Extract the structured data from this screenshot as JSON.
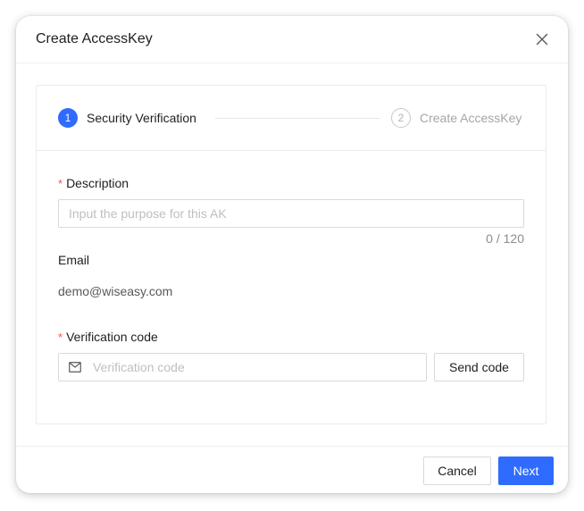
{
  "dialog": {
    "title": "Create AccessKey"
  },
  "steps": [
    {
      "number": "1",
      "label": "Security Verification",
      "state": "active"
    },
    {
      "number": "2",
      "label": "Create AccessKey",
      "state": "pending"
    }
  ],
  "form": {
    "description": {
      "required_mark": "*",
      "label": "Description",
      "value": "",
      "placeholder": "Input the purpose for this AK",
      "counter": "0 / 120"
    },
    "email": {
      "label": "Email",
      "value": "demo@wiseasy.com"
    },
    "verification_code": {
      "required_mark": "*",
      "label": "Verification code",
      "value": "",
      "placeholder": "Verification code",
      "icon": "mail-icon",
      "send_button_label": "Send code"
    }
  },
  "footer": {
    "cancel_label": "Cancel",
    "next_label": "Next"
  },
  "colors": {
    "primary": "#2f6bff",
    "required": "#ff4d4f",
    "border": "#d9d9d9",
    "placeholder": "#bfbfbf"
  }
}
